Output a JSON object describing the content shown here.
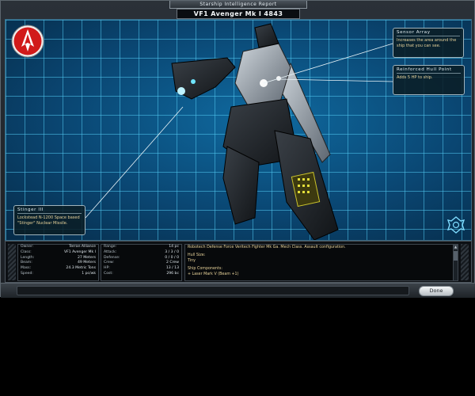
{
  "window": {
    "title": "Starship Intelligence Report",
    "ship_name": "VF1 Avenger Mk I 4843"
  },
  "colors": {
    "grid_line": "#50c8f0",
    "viewport_bg": "#0b3f66",
    "emblem_red": "#d11a1a",
    "callout_text": "#e7d29a"
  },
  "icons": {
    "faction": "faction-emblem-icon",
    "corner": "bug-emblem-icon"
  },
  "callouts": {
    "sensor": {
      "title": "Sensor Array",
      "body": "Increases the area around the ship that you can see."
    },
    "hull": {
      "title": "Reinforced Hull Point",
      "body": "Adds 5 HP to ship."
    },
    "stinger": {
      "title": "Stinger III",
      "body": "Lockstead N-1200 Space based \"Stinger\" Nuclear Missile."
    }
  },
  "stats": {
    "left": [
      {
        "label": "Owner:",
        "value": "Terran Alliance"
      },
      {
        "label": "Class:",
        "value": "VF1 Avenger Mk I"
      },
      {
        "label": "Length:",
        "value": "27 Meters"
      },
      {
        "label": "Beam:",
        "value": "49 Meters"
      },
      {
        "label": "Mass:",
        "value": "24.3 Metric Tons"
      },
      {
        "label": "Speed:",
        "value": "1 pc/wk"
      }
    ],
    "right": [
      {
        "label": "Range:",
        "value": "14 pc"
      },
      {
        "label": "Attack:",
        "value": "3 / 3 / 0"
      },
      {
        "label": "Defense:",
        "value": "0 / 0 / 0"
      },
      {
        "label": "Crew:",
        "value": "2 Crew"
      },
      {
        "label": "HP:",
        "value": "13 / 13"
      },
      {
        "label": "Cost:",
        "value": "296 bc"
      }
    ]
  },
  "description": {
    "summary": "Robotech Defense Force Veritech Fighter Mk Ga. Mech Class. Assault configuration.",
    "hull_size_label": "Hull Size:",
    "hull_size_value": "Tiny",
    "components_label": "Ship Components:",
    "components": [
      "+ Laser Mark V (Beam +1)"
    ]
  },
  "buttons": {
    "done": "Done"
  }
}
